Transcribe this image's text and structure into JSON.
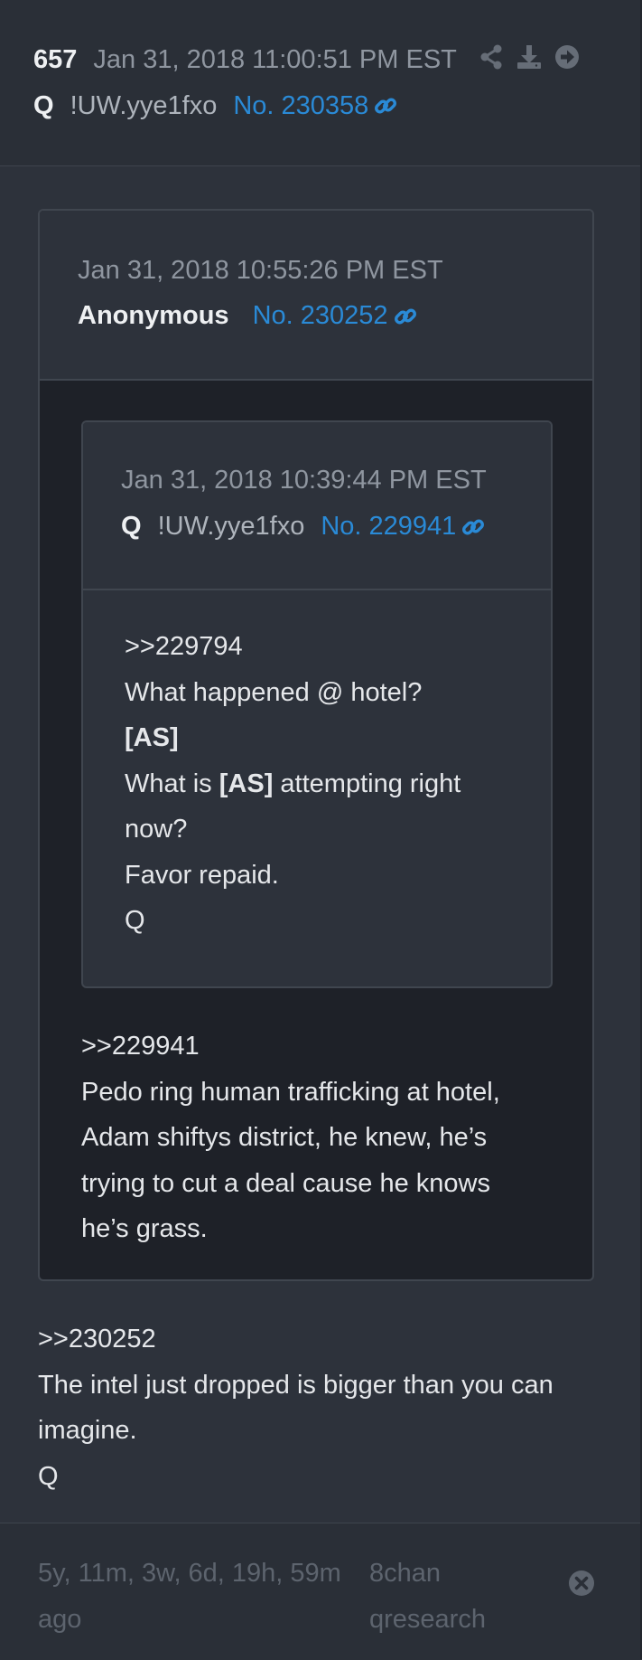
{
  "post": {
    "number": "657",
    "datetime": "Jan 31, 2018 11:00:51 PM EST",
    "author": "Q",
    "tripcode": "!UW.yye1fxo",
    "ref": "No. 230358",
    "icons": [
      "share-icon",
      "download-icon",
      "arrow-right-circle-icon"
    ]
  },
  "quoted_outer": {
    "datetime": "Jan 31, 2018 10:55:26 PM EST",
    "author": "Anonymous",
    "ref": "No. 230252",
    "body": [
      ">>229941",
      "Pedo ring human trafficking at hotel,",
      "Adam shiftys district, he knew, he’s",
      "trying to cut a deal cause he knows",
      "he’s grass."
    ]
  },
  "quoted_inner": {
    "datetime": "Jan 31, 2018 10:39:44 PM EST",
    "author": "Q",
    "tripcode": "!UW.yye1fxo",
    "ref": "No. 229941",
    "body": {
      "line1": ">>229794",
      "line2": "What happened @ hotel?",
      "line3": "[AS]",
      "line4_pre": "What is ",
      "line4_bold": "[AS]",
      "line4_post": " attempting right",
      "line5": "now?",
      "line6": "Favor repaid.",
      "line7": "Q"
    }
  },
  "body": [
    ">>230252",
    "The intel just dropped is bigger than you can",
    "imagine.",
    "Q"
  ],
  "footer": {
    "ago_line1": "5y, 11m, 3w, 6d, 19h, 59m",
    "ago_line2": "ago",
    "board_line1": "8chan",
    "board_line2": "qresearch",
    "close_icon": "close-circle-icon"
  },
  "colors": {
    "background": "#2d323b",
    "link": "#2a8ad6",
    "muted": "#8f96a0",
    "quote_background": "#1e2128"
  }
}
